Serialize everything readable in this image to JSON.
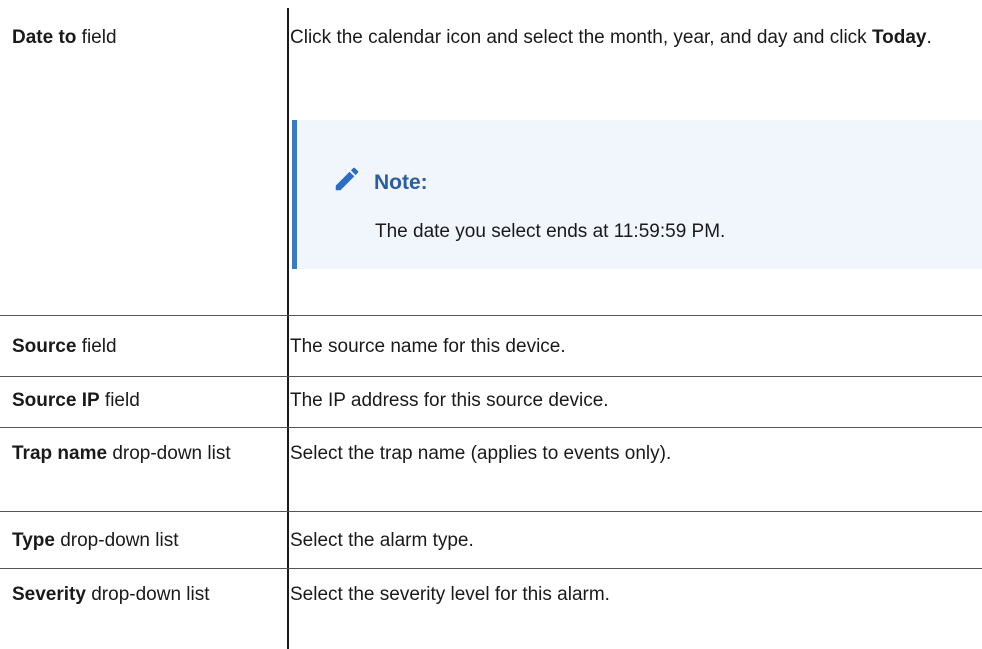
{
  "rows": [
    {
      "label": "Date to",
      "suffix": " field",
      "desc_pre": "Click the calendar icon and select the month, year, and day and click ",
      "desc_bold": "Today",
      "desc_post": ".",
      "note": {
        "icon": "pencil-icon",
        "title": "Note:",
        "text": "The date you select ends at 11:59:59 PM."
      }
    },
    {
      "label": "Source",
      "suffix": " field",
      "desc": "The source name for this device."
    },
    {
      "label": "Source IP",
      "suffix": " field",
      "desc": "The IP address for this source device."
    },
    {
      "label": "Trap name",
      "suffix": " drop-down list",
      "desc": "Select the trap name (applies to events only)."
    },
    {
      "label": "Type",
      "suffix": " drop-down list",
      "desc": "Select the alarm type."
    },
    {
      "label": "Severity",
      "suffix": " drop-down list",
      "desc": "Select the severity level for this alarm."
    }
  ],
  "colors": {
    "note_bg": "#f1f6fc",
    "note_accent": "#3a79c4",
    "note_title": "#2b5ea0"
  }
}
